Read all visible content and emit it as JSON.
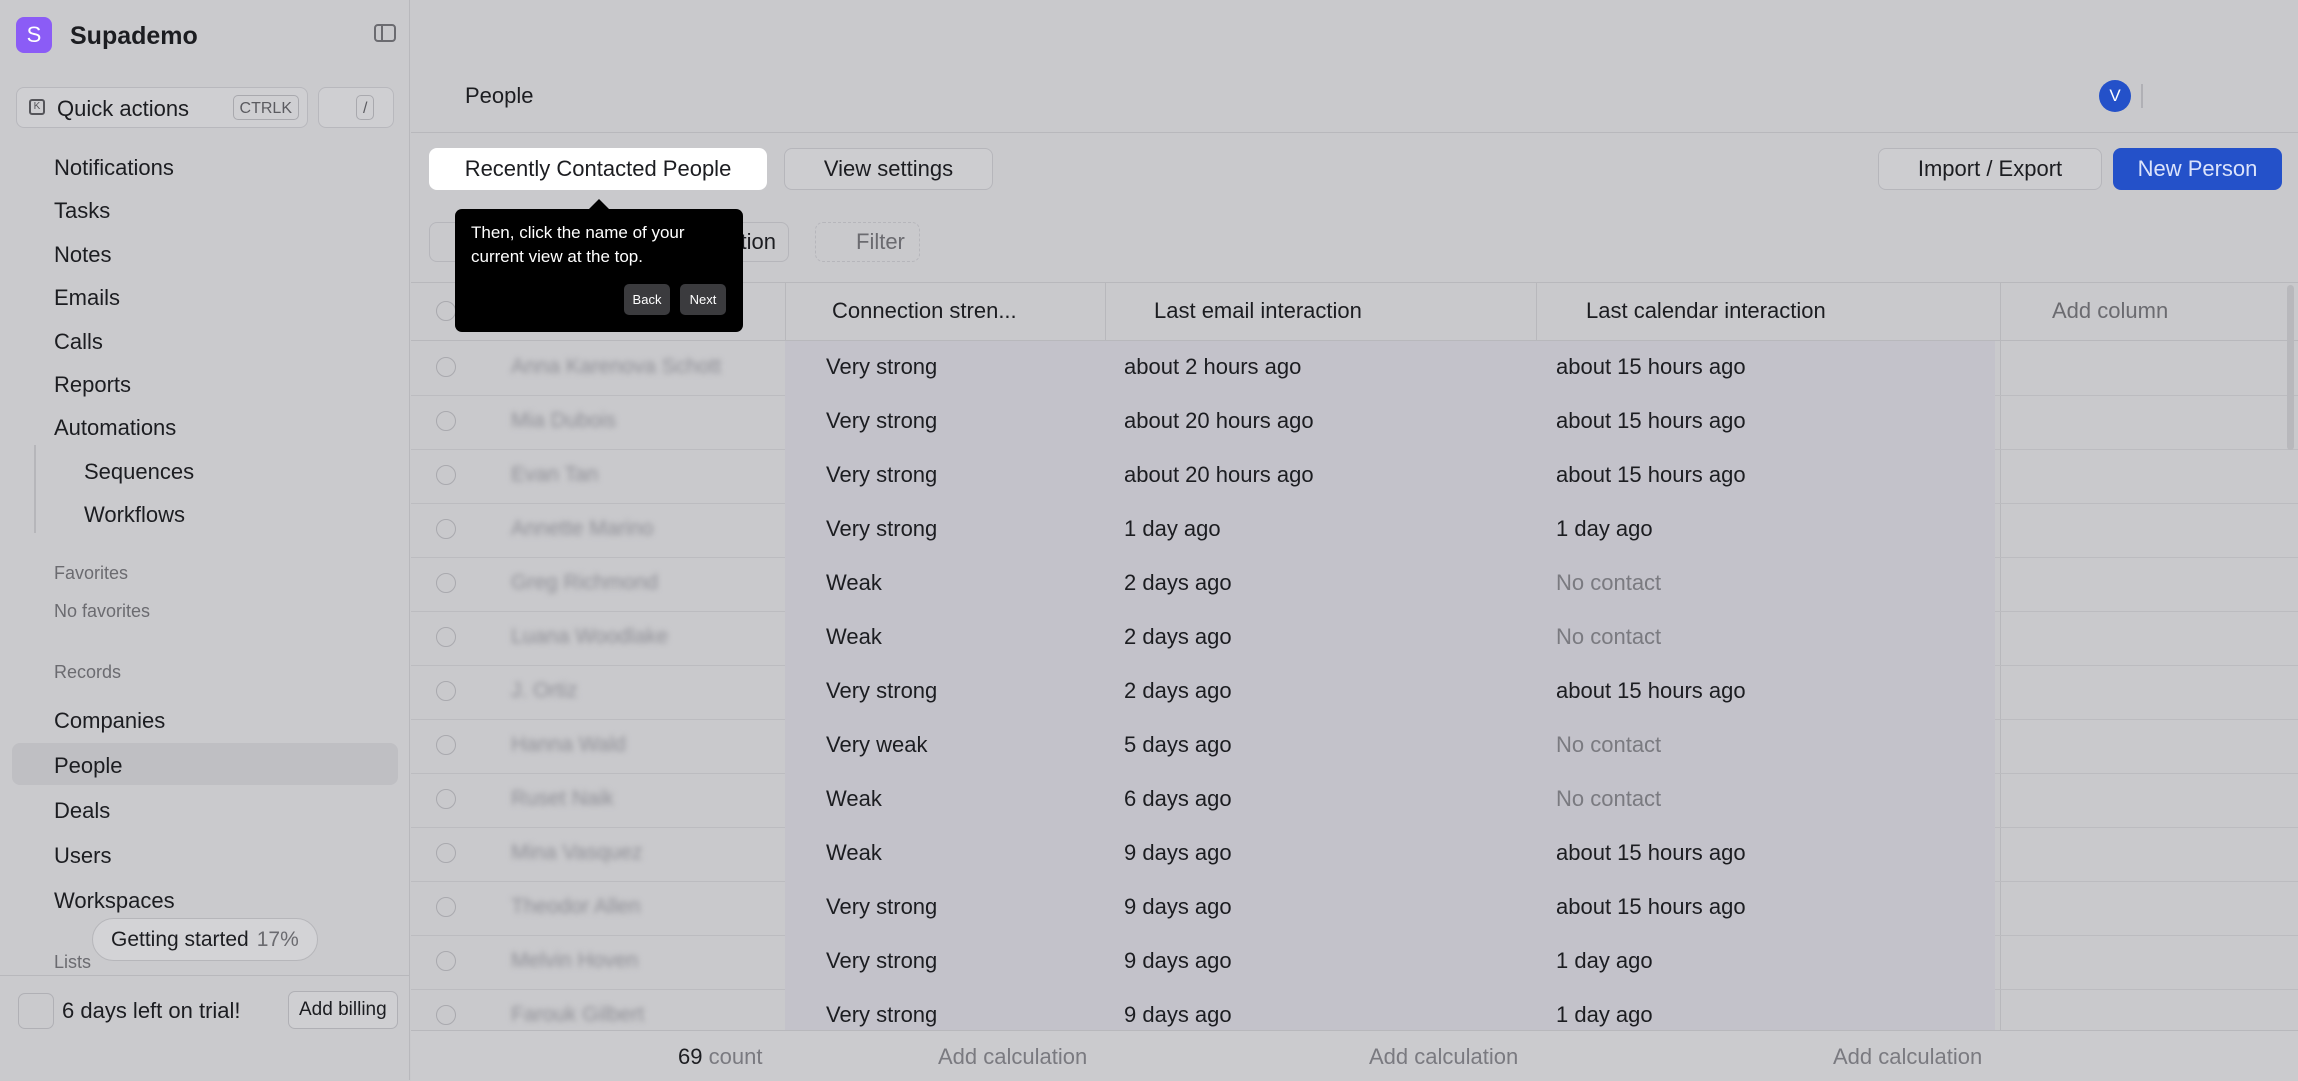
{
  "workspace": {
    "logo_letter": "S",
    "name": "Supademo"
  },
  "quick_actions": {
    "label": "Quick actions",
    "shortcut": "CTRLK",
    "slash": "/"
  },
  "nav": {
    "notifications": "Notifications",
    "tasks": "Tasks",
    "notes": "Notes",
    "emails": "Emails",
    "calls": "Calls",
    "reports": "Reports",
    "automations": "Automations",
    "sequences": "Sequences",
    "workflows": "Workflows"
  },
  "favorites": {
    "heading": "Favorites",
    "empty": "No favorites"
  },
  "records": {
    "heading": "Records",
    "companies": "Companies",
    "people": "People",
    "deals": "Deals",
    "users": "Users",
    "workspaces": "Workspaces"
  },
  "lists": {
    "heading": "Lists"
  },
  "getting_started": {
    "label": "Getting started",
    "percent": "17%"
  },
  "trial": {
    "text": "6 days left on trial!",
    "billing": "Add billing"
  },
  "header": {
    "title": "People",
    "avatar_letter": "V"
  },
  "views": {
    "current": "Recently Contacted People",
    "settings": "View settings",
    "import_export": "Import / Export",
    "new_person": "New Person"
  },
  "filters": {
    "partial_chip": "tion",
    "filter": "Filter"
  },
  "tooltip": {
    "text": "Then, click the name of your current view at the top.",
    "back": "Back",
    "next": "Next"
  },
  "table": {
    "columns": {
      "connection": "Connection stren...",
      "last_email": "Last email interaction",
      "last_calendar": "Last calendar interaction",
      "add_column": "Add column"
    },
    "rows": [
      {
        "name": "Anna Karenova Schott",
        "connection": "Very strong",
        "email": "about 2 hours ago",
        "calendar": "about 15 hours ago",
        "calendar_muted": false
      },
      {
        "name": "Mia Dubois",
        "connection": "Very strong",
        "email": "about 20 hours ago",
        "calendar": "about 15 hours ago",
        "calendar_muted": false
      },
      {
        "name": "Evan Tan",
        "connection": "Very strong",
        "email": "about 20 hours ago",
        "calendar": "about 15 hours ago",
        "calendar_muted": false
      },
      {
        "name": "Annette Marino",
        "connection": "Very strong",
        "email": "1 day ago",
        "calendar": "1 day ago",
        "calendar_muted": false
      },
      {
        "name": "Greg Richmond",
        "connection": "Weak",
        "email": "2 days ago",
        "calendar": "No contact",
        "calendar_muted": true
      },
      {
        "name": "Luana Woodlake",
        "connection": "Weak",
        "email": "2 days ago",
        "calendar": "No contact",
        "calendar_muted": true
      },
      {
        "name": "J. Ortiz",
        "connection": "Very strong",
        "email": "2 days ago",
        "calendar": "about 15 hours ago",
        "calendar_muted": false
      },
      {
        "name": "Hanna Wald",
        "connection": "Very weak",
        "email": "5 days ago",
        "calendar": "No contact",
        "calendar_muted": true
      },
      {
        "name": "Ruset Naik",
        "connection": "Weak",
        "email": "6 days ago",
        "calendar": "No contact",
        "calendar_muted": true
      },
      {
        "name": "Mina Vasquez",
        "connection": "Weak",
        "email": "9 days ago",
        "calendar": "about 15 hours ago",
        "calendar_muted": false
      },
      {
        "name": "Theodor Allen",
        "connection": "Very strong",
        "email": "9 days ago",
        "calendar": "about 15 hours ago",
        "calendar_muted": false
      },
      {
        "name": "Melvin Hoven",
        "connection": "Very strong",
        "email": "9 days ago",
        "calendar": "1 day ago",
        "calendar_muted": false
      },
      {
        "name": "Farouk Gilbert",
        "connection": "Very strong",
        "email": "9 days ago",
        "calendar": "1 day ago",
        "calendar_muted": false
      }
    ],
    "footer": {
      "count_value": "69",
      "count_label": "count",
      "add_calc": "Add calculation"
    }
  }
}
